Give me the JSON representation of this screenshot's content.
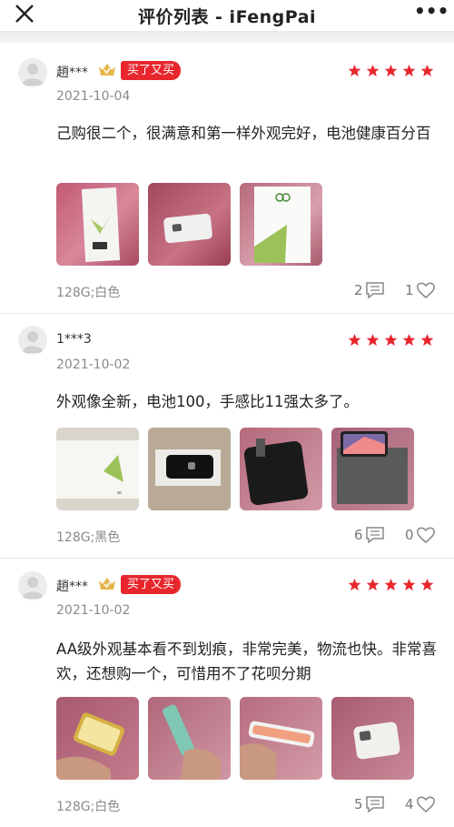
{
  "header": {
    "title": "评价列表 - iFengPai",
    "more": "•••"
  },
  "badge_label": "买了又买",
  "reviews": [
    {
      "user": "趙***",
      "vip": true,
      "repurchase": true,
      "rating": 5,
      "date": "2021-10-04",
      "text": "己购很二个，很满意和第一样外观完好，电池健康百分百",
      "photo_count": 3,
      "spec": "128G;白色",
      "comments": "2",
      "likes": "1"
    },
    {
      "user": "1***3",
      "vip": false,
      "repurchase": false,
      "rating": 5,
      "date": "2021-10-02",
      "text": "外观像全新，电池100，手感比11强太多了。",
      "photo_count": 4,
      "spec": "128G;黑色",
      "comments": "6",
      "likes": "0"
    },
    {
      "user": "趙***",
      "vip": true,
      "repurchase": true,
      "rating": 5,
      "date": "2021-10-02",
      "text": "AA级外观基本看不到划痕，非常完美，物流也快。非常喜欢，还想购一个，可惜用不了花呗分期",
      "photo_count": 4,
      "spec": "128G;白色",
      "comments": "5",
      "likes": "4"
    }
  ],
  "colors": {
    "accent": "#e8262d",
    "star": "#e8262d",
    "vip_gold": "#e6b54a",
    "muted": "#8a8a8a"
  },
  "icons": {
    "close": "close-icon",
    "more": "more-icon",
    "comment": "comment-icon",
    "like": "heart-icon",
    "star": "star-icon",
    "vip": "vip-crown-icon"
  }
}
